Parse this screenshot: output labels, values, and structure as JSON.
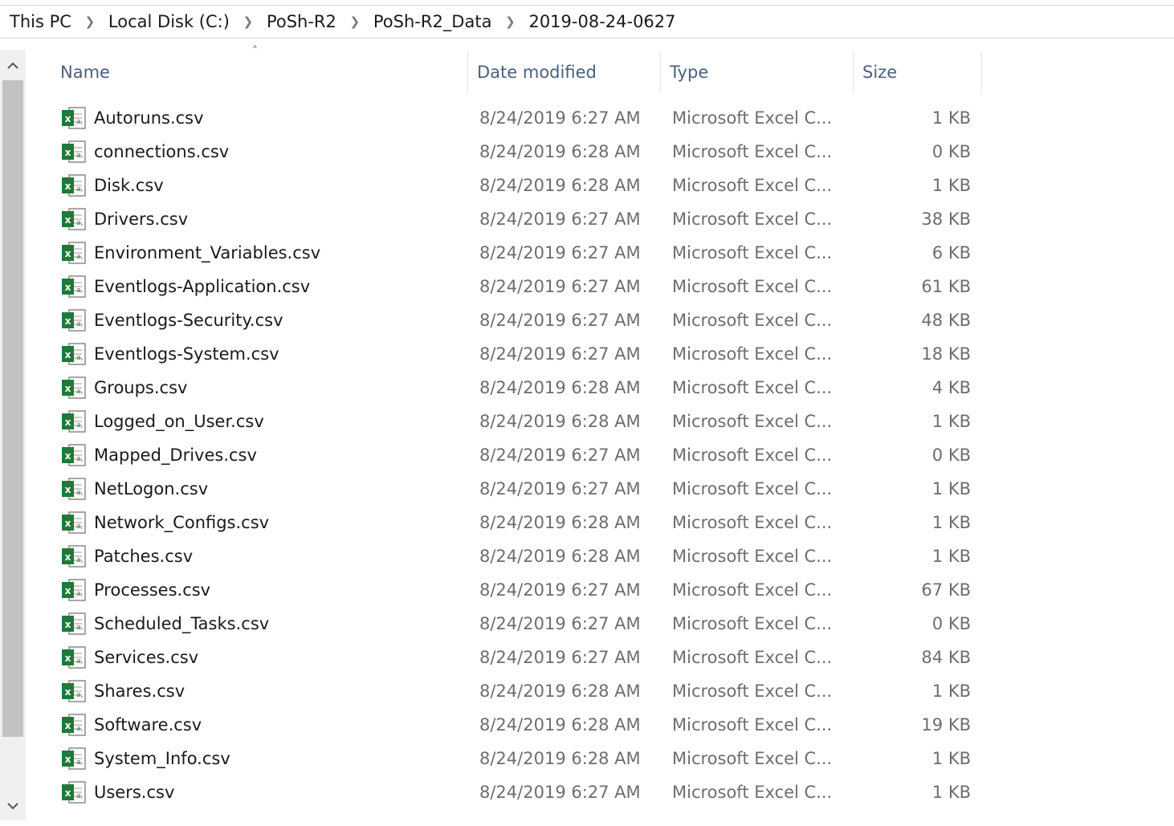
{
  "breadcrumb": [
    "This PC",
    "Local Disk (C:)",
    "PoSh-R2",
    "PoSh-R2_Data",
    "2019-08-24-0627"
  ],
  "columns": {
    "name": "Name",
    "date": "Date modified",
    "type": "Type",
    "size": "Size"
  },
  "sort": {
    "column": "name",
    "direction": "ascending"
  },
  "file_icon": "excel-csv-icon",
  "files": [
    {
      "name": "Autoruns.csv",
      "date": "8/24/2019 6:27 AM",
      "type": "Microsoft Excel C...",
      "size": "1 KB"
    },
    {
      "name": "connections.csv",
      "date": "8/24/2019 6:28 AM",
      "type": "Microsoft Excel C...",
      "size": "0 KB"
    },
    {
      "name": "Disk.csv",
      "date": "8/24/2019 6:28 AM",
      "type": "Microsoft Excel C...",
      "size": "1 KB"
    },
    {
      "name": "Drivers.csv",
      "date": "8/24/2019 6:27 AM",
      "type": "Microsoft Excel C...",
      "size": "38 KB"
    },
    {
      "name": "Environment_Variables.csv",
      "date": "8/24/2019 6:27 AM",
      "type": "Microsoft Excel C...",
      "size": "6 KB"
    },
    {
      "name": "Eventlogs-Application.csv",
      "date": "8/24/2019 6:27 AM",
      "type": "Microsoft Excel C...",
      "size": "61 KB"
    },
    {
      "name": "Eventlogs-Security.csv",
      "date": "8/24/2019 6:27 AM",
      "type": "Microsoft Excel C...",
      "size": "48 KB"
    },
    {
      "name": "Eventlogs-System.csv",
      "date": "8/24/2019 6:27 AM",
      "type": "Microsoft Excel C...",
      "size": "18 KB"
    },
    {
      "name": "Groups.csv",
      "date": "8/24/2019 6:28 AM",
      "type": "Microsoft Excel C...",
      "size": "4 KB"
    },
    {
      "name": "Logged_on_User.csv",
      "date": "8/24/2019 6:28 AM",
      "type": "Microsoft Excel C...",
      "size": "1 KB"
    },
    {
      "name": "Mapped_Drives.csv",
      "date": "8/24/2019 6:27 AM",
      "type": "Microsoft Excel C...",
      "size": "0 KB"
    },
    {
      "name": "NetLogon.csv",
      "date": "8/24/2019 6:27 AM",
      "type": "Microsoft Excel C...",
      "size": "1 KB"
    },
    {
      "name": "Network_Configs.csv",
      "date": "8/24/2019 6:28 AM",
      "type": "Microsoft Excel C...",
      "size": "1 KB"
    },
    {
      "name": "Patches.csv",
      "date": "8/24/2019 6:28 AM",
      "type": "Microsoft Excel C...",
      "size": "1 KB"
    },
    {
      "name": "Processes.csv",
      "date": "8/24/2019 6:27 AM",
      "type": "Microsoft Excel C...",
      "size": "67 KB"
    },
    {
      "name": "Scheduled_Tasks.csv",
      "date": "8/24/2019 6:27 AM",
      "type": "Microsoft Excel C...",
      "size": "0 KB"
    },
    {
      "name": "Services.csv",
      "date": "8/24/2019 6:27 AM",
      "type": "Microsoft Excel C...",
      "size": "84 KB"
    },
    {
      "name": "Shares.csv",
      "date": "8/24/2019 6:28 AM",
      "type": "Microsoft Excel C...",
      "size": "1 KB"
    },
    {
      "name": "Software.csv",
      "date": "8/24/2019 6:28 AM",
      "type": "Microsoft Excel C...",
      "size": "19 KB"
    },
    {
      "name": "System_Info.csv",
      "date": "8/24/2019 6:28 AM",
      "type": "Microsoft Excel C...",
      "size": "1 KB"
    },
    {
      "name": "Users.csv",
      "date": "8/24/2019 6:27 AM",
      "type": "Microsoft Excel C...",
      "size": "1 KB"
    }
  ],
  "colors": {
    "header_text": "#4c607a",
    "excel_green": "#1f7a3a",
    "secondary_text": "#6d6d6d"
  }
}
